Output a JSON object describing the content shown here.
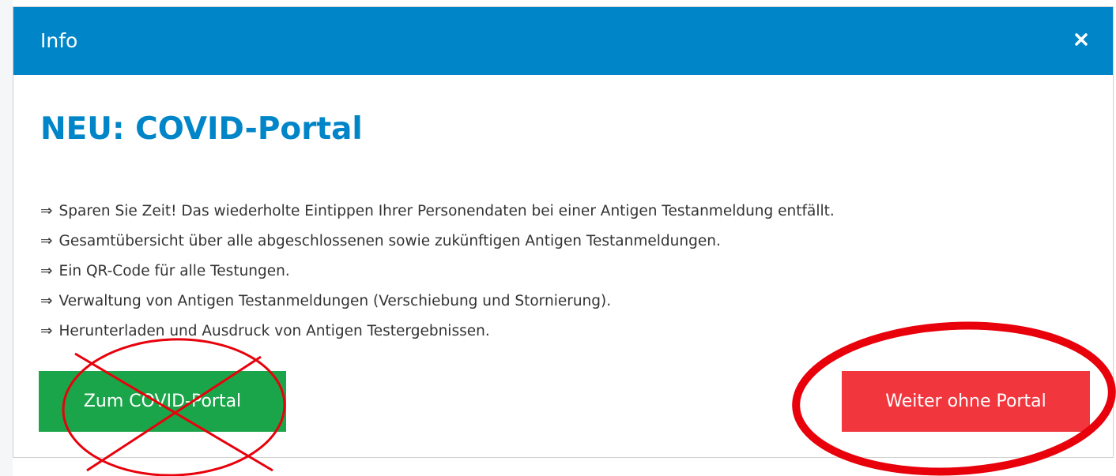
{
  "modal": {
    "title": "Info",
    "heading": "NEU: COVID-Portal",
    "features": [
      {
        "arrow": "⇒",
        "text": "Sparen Sie Zeit! Das wiederholte Eintippen Ihrer Personendaten bei einer Antigen Testanmeldung entfällt."
      },
      {
        "arrow": "⇒",
        "text": "Gesamtübersicht über alle abgeschlossenen sowie zukünftigen Antigen Testanmeldungen."
      },
      {
        "arrow": "⇒",
        "text": "Ein QR-Code für alle Testungen."
      },
      {
        "arrow": "⇒",
        "text": "Verwaltung von Antigen Testanmeldungen (Verschiebung und Stornierung)."
      },
      {
        "arrow": "⇒",
        "text": "Herunterladen und Ausdruck von Antigen Testergebnissen."
      }
    ],
    "buttons": {
      "portal_label": "Zum COVID-Portal",
      "continue_label": "Weiter ohne Portal"
    },
    "icons": {
      "close": "close-icon"
    }
  },
  "colors": {
    "header_bg": "#0086c8",
    "heading": "#0086c8",
    "portal_button": "#1aa54a",
    "continue_button": "#f1363e",
    "annotation": "#e8000b"
  }
}
